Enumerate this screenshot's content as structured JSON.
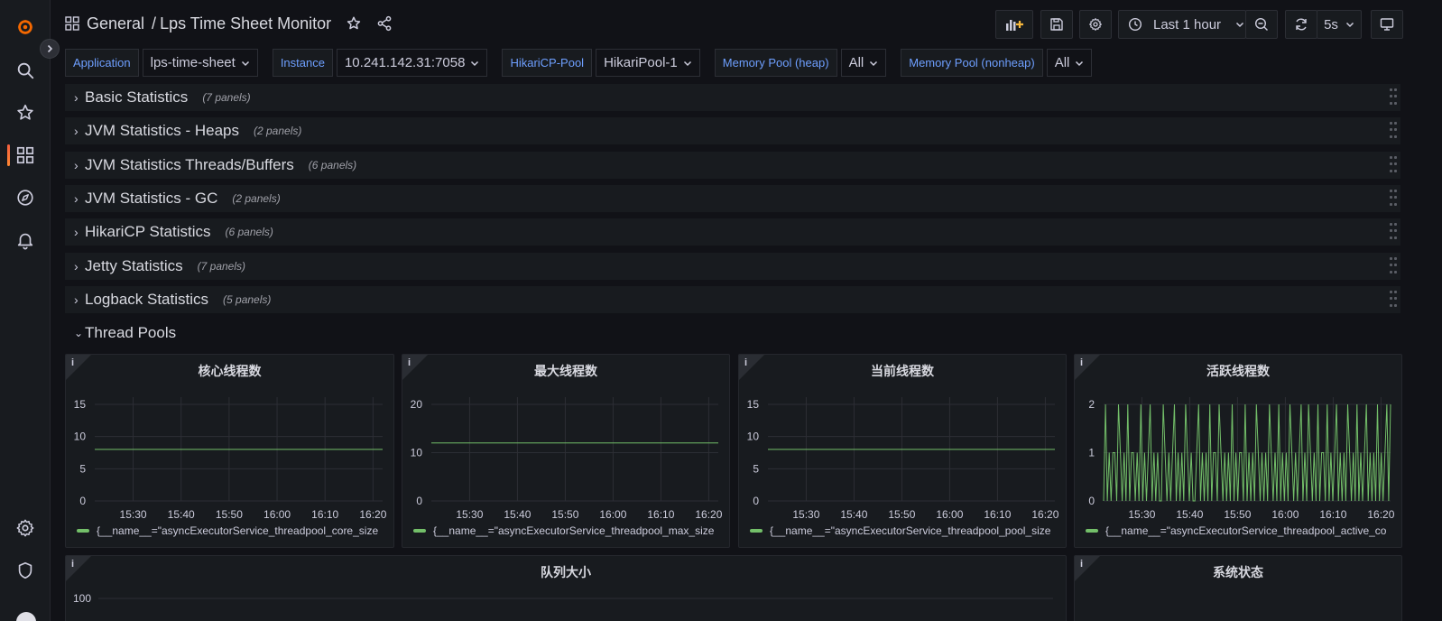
{
  "breadcrumb": {
    "folder": "General",
    "separator": "/",
    "title": "Lps Time Sheet Monitor"
  },
  "toolbar": {
    "time_range": "Last 1 hour",
    "refresh_interval": "5s"
  },
  "variables": [
    {
      "label": "Application",
      "value": "lps-time-sheet"
    },
    {
      "label": "Instance",
      "value": "10.241.142.31:7058"
    },
    {
      "label": "HikariCP-Pool",
      "value": "HikariPool-1"
    },
    {
      "label": "Memory Pool (heap)",
      "value": "All"
    },
    {
      "label": "Memory Pool (nonheap)",
      "value": "All"
    }
  ],
  "rows": [
    {
      "title": "Basic Statistics",
      "count": "(7 panels)"
    },
    {
      "title": "JVM Statistics - Heaps",
      "count": "(2 panels)"
    },
    {
      "title": "JVM Statistics Threads/Buffers",
      "count": "(6 panels)"
    },
    {
      "title": "JVM Statistics - GC",
      "count": "(2 panels)"
    },
    {
      "title": "HikariCP Statistics",
      "count": "(6 panels)"
    },
    {
      "title": "Jetty Statistics",
      "count": "(7 panels)"
    },
    {
      "title": "Logback Statistics",
      "count": "(5 panels)"
    }
  ],
  "open_row": {
    "title": "Thread Pools"
  },
  "colors": {
    "series": "#73bf69",
    "accent": "#f55f3e",
    "label_blue": "#6e9fff"
  },
  "chart_data": [
    {
      "type": "line",
      "title": "核心线程数",
      "x_ticks": [
        "15:30",
        "15:40",
        "15:50",
        "16:00",
        "16:10",
        "16:20"
      ],
      "y_ticks": [
        "0",
        "5",
        "10",
        "15"
      ],
      "ylim": [
        0,
        15
      ],
      "series": [
        {
          "name": "{__name__=\"asyncExecutorService_threadpool_core_size",
          "values": [
            8,
            8
          ]
        }
      ]
    },
    {
      "type": "line",
      "title": "最大线程数",
      "x_ticks": [
        "15:30",
        "15:40",
        "15:50",
        "16:00",
        "16:10",
        "16:20"
      ],
      "y_ticks": [
        "0",
        "10",
        "20"
      ],
      "ylim": [
        0,
        20
      ],
      "series": [
        {
          "name": "{__name__=\"asyncExecutorService_threadpool_max_size",
          "values": [
            12,
            12
          ]
        }
      ]
    },
    {
      "type": "line",
      "title": "当前线程数",
      "x_ticks": [
        "15:30",
        "15:40",
        "15:50",
        "16:00",
        "16:10",
        "16:20"
      ],
      "y_ticks": [
        "0",
        "5",
        "10",
        "15"
      ],
      "ylim": [
        0,
        15
      ],
      "series": [
        {
          "name": "{__name__=\"asyncExecutorService_threadpool_pool_size",
          "values": [
            8,
            8
          ]
        }
      ]
    },
    {
      "type": "line",
      "title": "活跃线程数",
      "x_ticks": [
        "15:30",
        "15:40",
        "15:50",
        "16:00",
        "16:10",
        "16:20"
      ],
      "y_ticks": [
        "0",
        "1",
        "2"
      ],
      "ylim": [
        0,
        2
      ],
      "series": [
        {
          "name": "{__name__=\"asyncExecutorService_threadpool_active_co",
          "values": [
            0,
            2,
            0,
            1,
            0,
            1,
            1,
            0,
            2,
            1,
            0,
            1,
            0,
            2,
            0,
            1,
            1,
            0,
            1,
            0,
            2,
            0,
            1,
            0,
            1,
            2,
            0,
            1,
            0,
            1,
            0,
            0,
            2,
            1,
            0,
            1,
            0,
            1,
            2,
            0,
            1,
            0,
            1,
            0,
            2,
            1,
            0,
            1,
            0,
            0,
            1,
            2,
            0,
            1,
            0,
            1,
            0,
            2,
            0,
            1,
            1,
            0,
            2,
            1,
            0,
            1,
            0,
            1,
            0,
            2,
            0,
            1,
            0,
            1,
            1,
            0,
            2,
            0,
            1,
            0,
            1,
            0,
            2,
            1,
            0,
            1,
            0,
            1,
            0,
            2,
            1,
            0,
            1,
            0,
            2,
            0,
            1,
            0,
            1,
            0,
            2,
            1,
            0,
            1,
            0,
            1,
            2,
            0,
            1,
            0,
            2,
            1,
            0,
            1,
            0,
            2,
            0,
            1,
            1,
            0,
            2,
            0,
            1,
            0,
            1,
            2,
            0,
            1,
            0,
            1,
            0,
            2,
            1,
            0,
            1,
            0,
            2,
            0,
            1,
            0,
            1,
            2,
            0,
            1,
            0,
            1,
            0,
            2,
            0,
            1,
            0,
            1,
            2,
            0,
            2
          ]
        }
      ]
    },
    {
      "type": "line",
      "title": "队列大小",
      "y_ticks": [
        "100"
      ]
    },
    {
      "type": "table",
      "title": "系统状态"
    }
  ]
}
